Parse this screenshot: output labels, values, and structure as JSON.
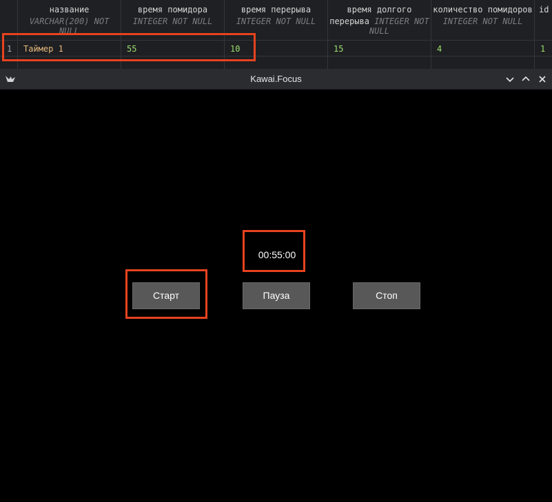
{
  "db_table": {
    "columns": [
      {
        "name": "",
        "type": ""
      },
      {
        "name": "название",
        "type": "VARCHAR(200) NOT NULL"
      },
      {
        "name": "время помидора",
        "type": "INTEGER NOT NULL"
      },
      {
        "name": "время перерыва",
        "type": "INTEGER NOT NULL"
      },
      {
        "name": "время долгого перерыва",
        "type": "INTEGER NOT NULL"
      },
      {
        "name": "количество помидоров",
        "type": "INTEGER NOT NULL"
      },
      {
        "name": "id",
        "type": ""
      }
    ],
    "header_lines": {
      "name_1": "название",
      "name_2": "VARCHAR(200) NOT",
      "name_3": "NULL",
      "pomodoro_1": "время помидора",
      "pomodoro_2": "INTEGER NOT NULL",
      "break_1": "время перерыва",
      "break_2": "INTEGER NOT NULL",
      "long_1": "время долгого",
      "long_2a": "перерыва",
      "long_2b": "INTEGER NOT",
      "long_3": "NULL",
      "count_1": "количество помидоров",
      "count_2": "INTEGER NOT NULL",
      "id_1": "id"
    },
    "rows": [
      {
        "row_number": "1",
        "name": "Таймер 1",
        "pomodoro_time": "55",
        "break_time": "10",
        "long_break_time": "15",
        "pomodoro_count": "4",
        "id": "1"
      }
    ]
  },
  "window": {
    "title": "Kawai.Focus",
    "icons": {
      "app": "kivy-logo-icon",
      "minimize": "chevron-down-icon",
      "maximize": "chevron-up-icon",
      "close": "close-icon"
    }
  },
  "timer": {
    "display": "00:55:00"
  },
  "buttons": {
    "start": "Старт",
    "pause": "Пауза",
    "stop": "Стоп"
  },
  "colors": {
    "annotation": "#e8431f",
    "button_bg": "#585858",
    "number_value": "#9ee06f",
    "string_value": "#e8bc7d"
  }
}
